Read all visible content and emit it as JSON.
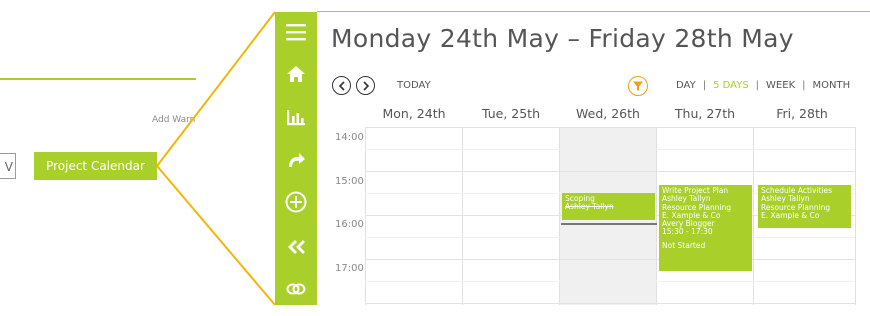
{
  "background_app": {
    "add_link": "Add Warn",
    "input_value": "V",
    "project_button": "Project Calendar"
  },
  "toolbar": {
    "icons": [
      "menu-icon",
      "home-icon",
      "chart-icon",
      "redo-icon",
      "add-icon",
      "collapse-icon",
      "link-icon"
    ]
  },
  "calendar": {
    "title": "Monday 24th May – Friday 28th May",
    "today_label": "TODAY",
    "views": [
      {
        "label": "DAY",
        "active": false
      },
      {
        "label": "5 DAYS",
        "active": true
      },
      {
        "label": "WEEK",
        "active": false
      },
      {
        "label": "MONTH",
        "active": false
      }
    ],
    "days": [
      "Mon, 24th",
      "Tue, 25th",
      "Wed, 26th",
      "Thu, 27th",
      "Fri, 28th"
    ],
    "times": [
      "14:00",
      "15:00",
      "16:00",
      "17:00"
    ],
    "events": {
      "wed": [
        "Scoping",
        "Ashley Tallyn"
      ],
      "thu": [
        "Write Project Plan",
        "Ashley Tallyn",
        "Resource Planning",
        "E. Xample & Co",
        "Avery Blogger",
        "15:30 - 17:30",
        "",
        "Not Started"
      ],
      "fri": [
        "Schedule Activities",
        "Ashley Tallyn",
        "Resource Planning",
        "E. Xample & Co"
      ]
    }
  },
  "colors": {
    "accent_green": "#a8cf2a",
    "callout_yellow": "#f2b705",
    "filter_orange": "#f0a11c"
  }
}
